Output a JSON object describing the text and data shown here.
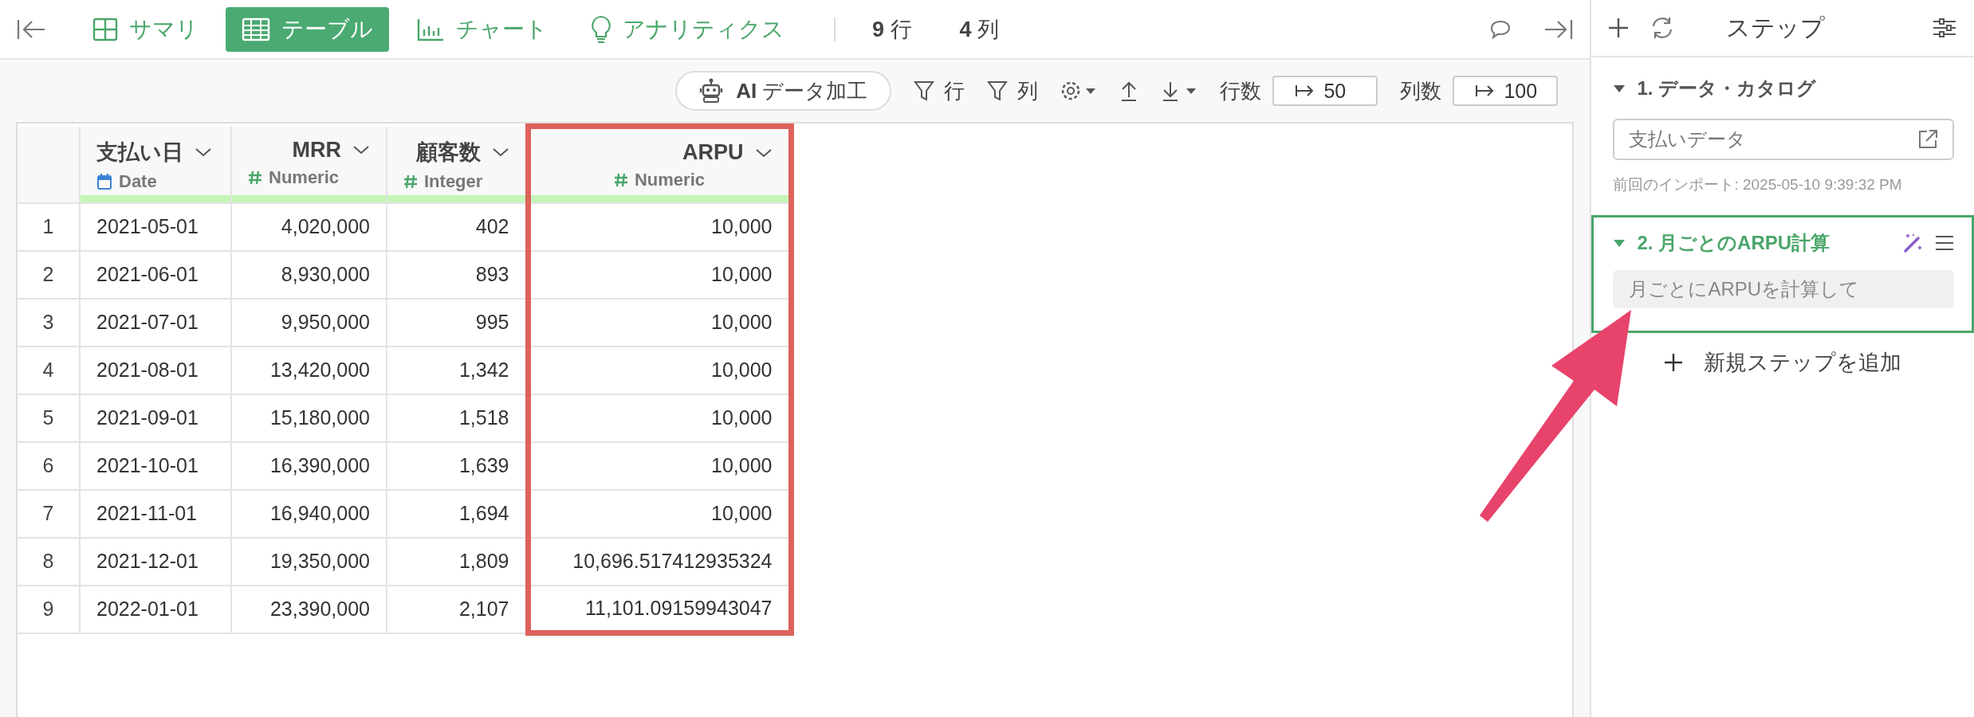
{
  "nav": {
    "tabs": [
      {
        "label": "サマリ",
        "kind": "summary",
        "selected": false
      },
      {
        "label": "テーブル",
        "kind": "table",
        "selected": true
      },
      {
        "label": "チャート",
        "kind": "chart",
        "selected": false
      },
      {
        "label": "アナリティクス",
        "kind": "analytics",
        "selected": false
      }
    ],
    "row_count": {
      "value": "9",
      "unit": "行"
    },
    "column_count": {
      "value": "4",
      "unit": "列"
    }
  },
  "toolbar": {
    "ai_button": "**AI** データ加工",
    "row_filter": "行",
    "column_filter": "列",
    "row_limit": {
      "label": "行数",
      "value": "50"
    },
    "column_limit": {
      "label": "列数",
      "value": "100"
    }
  },
  "table": {
    "columns": [
      {
        "name": "支払い日",
        "type": "Date",
        "kind": "date",
        "highlighted": false
      },
      {
        "name": "MRR",
        "type": "Numeric",
        "kind": "number",
        "highlighted": false
      },
      {
        "name": "顧客数",
        "type": "Integer",
        "kind": "number",
        "highlighted": false
      },
      {
        "name": "ARPU",
        "type": "Numeric",
        "kind": "number",
        "highlighted": true
      }
    ],
    "rows": [
      {
        "number": "1",
        "cells": [
          "2021-05-01",
          "4,020,000",
          "402",
          "10,000"
        ]
      },
      {
        "number": "2",
        "cells": [
          "2021-06-01",
          "8,930,000",
          "893",
          "10,000"
        ]
      },
      {
        "number": "3",
        "cells": [
          "2021-07-01",
          "9,950,000",
          "995",
          "10,000"
        ]
      },
      {
        "number": "4",
        "cells": [
          "2021-08-01",
          "13,420,000",
          "1,342",
          "10,000"
        ]
      },
      {
        "number": "5",
        "cells": [
          "2021-09-01",
          "15,180,000",
          "1,518",
          "10,000"
        ]
      },
      {
        "number": "6",
        "cells": [
          "2021-10-01",
          "16,390,000",
          "1,639",
          "10,000"
        ]
      },
      {
        "number": "7",
        "cells": [
          "2021-11-01",
          "16,940,000",
          "1,694",
          "10,000"
        ]
      },
      {
        "number": "8",
        "cells": [
          "2021-12-01",
          "19,350,000",
          "1,809",
          "10,696.517412935324"
        ]
      },
      {
        "number": "9",
        "cells": [
          "2022-01-01",
          "23,390,000",
          "2,107",
          "11,101.09159943047"
        ]
      }
    ]
  },
  "steps_panel": {
    "title": "ステップ",
    "steps": [
      {
        "kind": "catalog",
        "title": "1. データ・カタログ",
        "expanded": true,
        "selected": false,
        "source": "支払いデータ",
        "note": "前回のインポート: 2025-05-10 9:39:32 PM"
      },
      {
        "kind": "ai",
        "title": "2. 月ごとのARPU計算",
        "expanded": true,
        "selected": true,
        "prompt": "月ごとにARPUを計算して"
      }
    ],
    "add_step": "新規ステップを追加"
  }
}
